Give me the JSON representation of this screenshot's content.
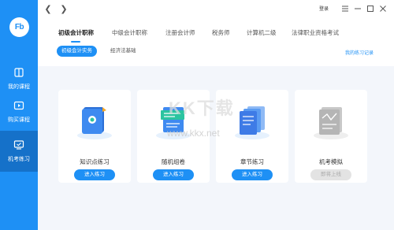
{
  "sidebar": {
    "logo": "Fb",
    "items": [
      {
        "label": "我的课程",
        "icon": "book-icon",
        "active": false
      },
      {
        "label": "购买课程",
        "icon": "play-icon",
        "active": false
      },
      {
        "label": "机考练习",
        "icon": "computer-test-icon",
        "active": true
      }
    ]
  },
  "topbar": {
    "login_label": "登录",
    "window_controls": [
      "menu-icon",
      "minimize-icon",
      "maximize-icon",
      "close-icon"
    ]
  },
  "tabs": [
    {
      "label": "初级会计职称",
      "active": true
    },
    {
      "label": "中级会计职称",
      "active": false
    },
    {
      "label": "注册会计师",
      "active": false
    },
    {
      "label": "税务师",
      "active": false
    },
    {
      "label": "计算机二级",
      "active": false
    },
    {
      "label": "法律职业资格考试",
      "active": false
    }
  ],
  "subtabs": [
    {
      "label": "初级会计实务",
      "active": true
    },
    {
      "label": "经济法基础",
      "active": false
    }
  ],
  "records_link": "我的练习记录",
  "cards": [
    {
      "title": "知识点练习",
      "button": "进入练习",
      "enabled": true,
      "icon": "knowledge-book-icon"
    },
    {
      "title": "随机组卷",
      "button": "进入练习",
      "enabled": true,
      "icon": "random-paper-icon"
    },
    {
      "title": "章节练习",
      "button": "进入练习",
      "enabled": true,
      "icon": "chapter-docs-icon"
    },
    {
      "title": "机考模拟",
      "button": "即将上线",
      "enabled": false,
      "icon": "exam-document-icon"
    }
  ],
  "watermark": {
    "text": "KK下载",
    "url": "www.kkx.net"
  },
  "colors": {
    "accent": "#1e90f5",
    "sidebar_active": "#1571c9",
    "background": "#f3f6fb",
    "disabled": "#e3e3e3"
  }
}
